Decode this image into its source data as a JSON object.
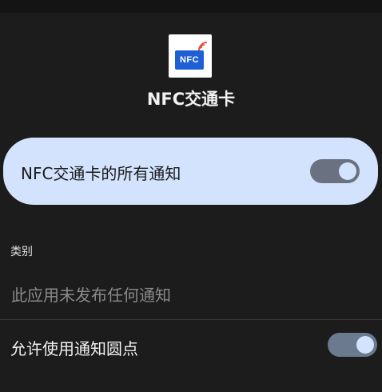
{
  "app": {
    "name": "NFC交通卡",
    "icon_text": "NFC"
  },
  "master": {
    "label": "NFC交通卡的所有通知",
    "enabled": true
  },
  "category": {
    "header": "类别",
    "empty_message": "此应用未发布任何通知"
  },
  "dots": {
    "label": "允许使用通知圆点",
    "enabled": true
  },
  "colors": {
    "background": "#1c1c1c",
    "card": "#d3e3fd",
    "toggle_track": "#6b7a8f",
    "toggle_thumb": "#d3e3fd",
    "nfc_blue": "#1e5fd6",
    "nfc_wave": "#e94b3c"
  }
}
